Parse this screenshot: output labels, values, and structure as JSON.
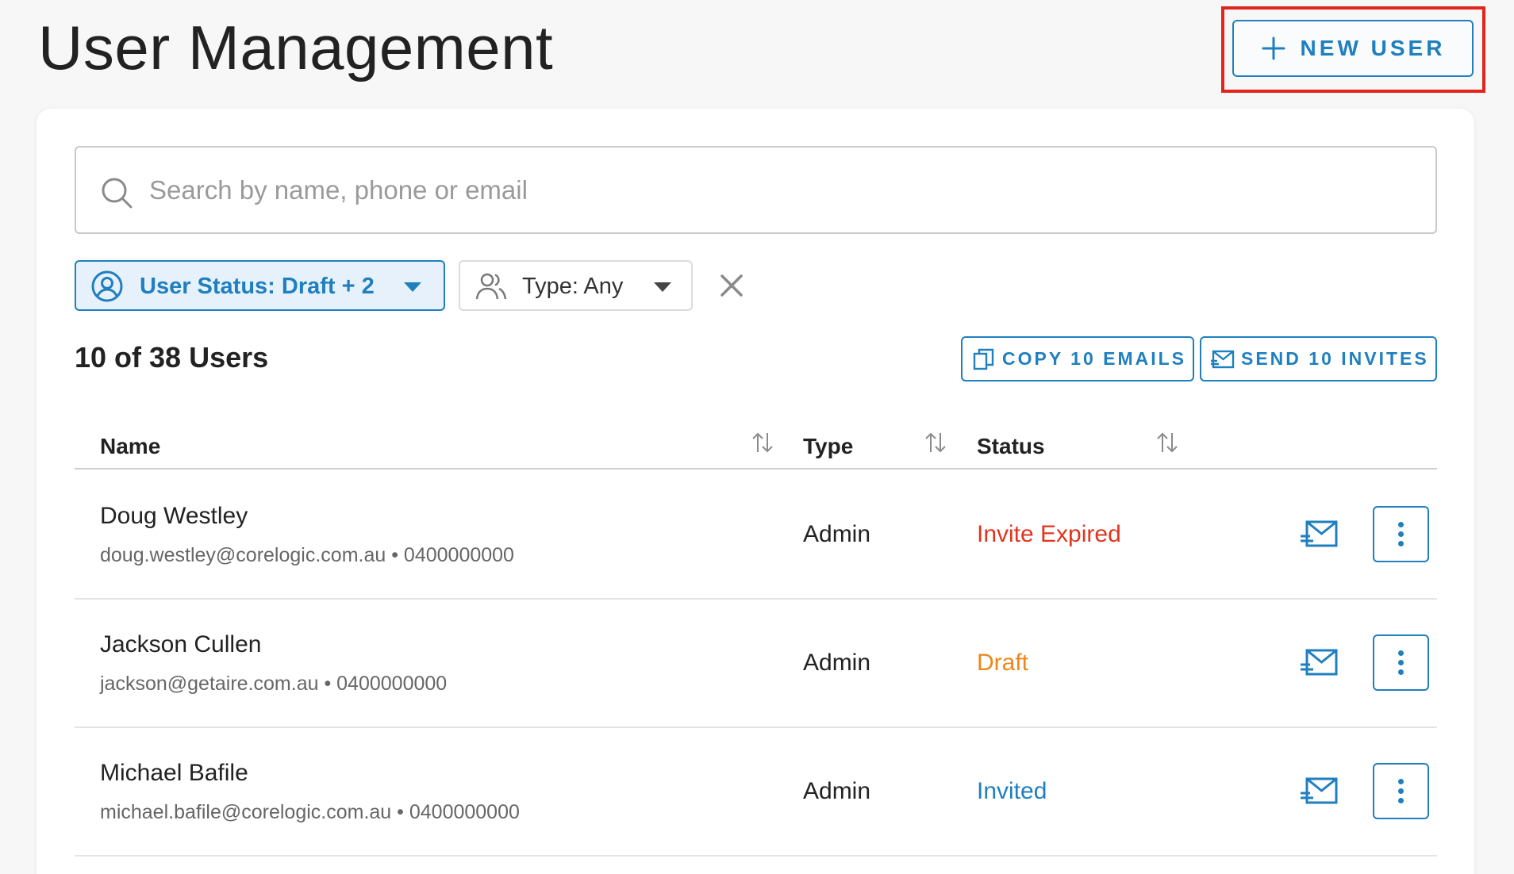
{
  "page": {
    "title": "User Management"
  },
  "header": {
    "new_user_label": "NEW USER"
  },
  "search": {
    "placeholder": "Search by name, phone or email",
    "value": ""
  },
  "filters": {
    "status_label": "User Status: Draft + 2",
    "type_label": "Type: Any"
  },
  "summary": {
    "count_text": "10 of 38 Users"
  },
  "actions": {
    "copy_label": "COPY 10 EMAILS",
    "send_label": "SEND 10 INVITES"
  },
  "table": {
    "columns": {
      "name": "Name",
      "type": "Type",
      "status": "Status"
    },
    "rows": [
      {
        "name": "Doug Westley",
        "contact": "doug.westley@corelogic.com.au • 0400000000",
        "type": "Admin",
        "status": "Invite Expired",
        "status_color": "#e0351f"
      },
      {
        "name": "Jackson Cullen",
        "contact": "jackson@getaire.com.au • 0400000000",
        "type": "Admin",
        "status": "Draft",
        "status_color": "#f0861a"
      },
      {
        "name": "Michael Bafile",
        "contact": "michael.bafile@corelogic.com.au • 0400000000",
        "type": "Admin",
        "status": "Invited",
        "status_color": "#1f7fbf"
      }
    ]
  },
  "colors": {
    "accent": "#1f7fbf",
    "highlight": "#e0251b"
  },
  "icons": {
    "new_user": "plus-icon",
    "search": "search-icon",
    "status_filter": "user-circle-icon",
    "type_filter": "users-icon",
    "clear": "close-icon",
    "copy": "copy-icon",
    "send": "send-mail-icon",
    "sort": "sort-icon",
    "row_mail": "send-mail-icon",
    "row_more": "more-vertical-icon"
  }
}
